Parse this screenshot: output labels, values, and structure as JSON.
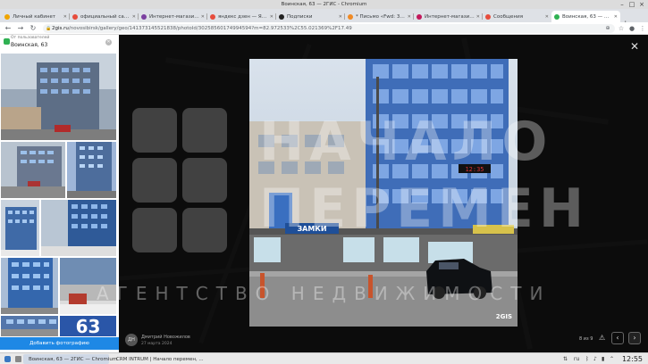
{
  "window": {
    "title": "Воинская, 63 — 2ГИС - Chromium"
  },
  "tabs": [
    {
      "label": "Личный кабинет",
      "color": "#f0a500"
    },
    {
      "label": "официальный сайт ин",
      "color": "#e74c3c"
    },
    {
      "label": "Интернет-магазин Ил",
      "color": "#7b3fa0"
    },
    {
      "label": "яндекс дзен — Яндекс",
      "color": "#e74c3c"
    },
    {
      "label": "Подписки",
      "color": "#222222"
    },
    {
      "label": "* Письмо «Fwd: 393.2",
      "color": "#f08a24"
    },
    {
      "label": "Интернет-магазин об",
      "color": "#c2185b"
    },
    {
      "label": "Сообщения",
      "color": "#e74c3c"
    },
    {
      "label": "Воинская, 63 — 2ГИС",
      "color": "#2fb152"
    }
  ],
  "address": {
    "host": "2gis.ru",
    "path": "/novosibirsk/gallery/geo/141373145521838/photoId/30258560174994594?m=82.972533%2C55.021369%2F17.49"
  },
  "gallery": {
    "caption": "От пользователей",
    "title": "Воинская, 63",
    "sign_text": "63",
    "add_photo": "Добавить фотографию"
  },
  "viewer": {
    "watermark": "2GIS",
    "author_initials": "ДН",
    "author_name": "Дмитрий Новожилов",
    "date": "27 марта 2024",
    "counter": "8 из 9",
    "close": "✕"
  },
  "watermark": {
    "line1": "НАЧАЛО",
    "line2": "ПЕРЕМЕН",
    "line3": "АГЕНТСТВО НЕДВИЖИМОСТИ"
  },
  "photo_signs": {
    "shop": "ЗАМКИ",
    "display": "12:35"
  },
  "taskbar": {
    "items": [
      {
        "label": "Воинская, 63 — 2ГИС — Chromium",
        "color": "#4285f4"
      },
      {
        "label": "CRM INTRUM | Начало перемен, ...",
        "color": "#4285f4"
      }
    ],
    "lang": "ru",
    "clock": "12:55"
  }
}
